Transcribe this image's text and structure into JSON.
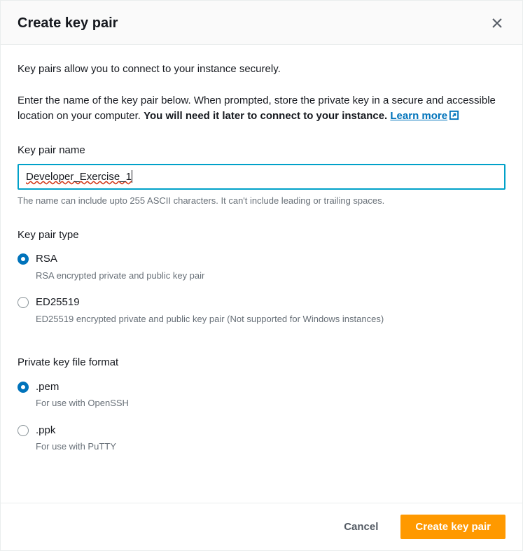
{
  "header": {
    "title": "Create key pair"
  },
  "intro": {
    "line1": "Key pairs allow you to connect to your instance securely.",
    "line2_prefix": "Enter the name of the key pair below. When prompted, store the private key in a secure and accessible location on your computer. ",
    "line2_bold": "You will need it later to connect to your instance.",
    "learn_more": "Learn more"
  },
  "name_field": {
    "label": "Key pair name",
    "value": "Developer_Exercise_1",
    "help": "The name can include upto 255 ASCII characters. It can't include leading or trailing spaces."
  },
  "type_group": {
    "label": "Key pair type",
    "options": [
      {
        "title": "RSA",
        "desc": "RSA encrypted private and public key pair",
        "selected": true
      },
      {
        "title": "ED25519",
        "desc": "ED25519 encrypted private and public key pair (Not supported for Windows instances)",
        "selected": false
      }
    ]
  },
  "format_group": {
    "label": "Private key file format",
    "options": [
      {
        "title": ".pem",
        "desc": "For use with OpenSSH",
        "selected": true
      },
      {
        "title": ".ppk",
        "desc": "For use with PuTTY",
        "selected": false
      }
    ]
  },
  "footer": {
    "cancel": "Cancel",
    "create": "Create key pair"
  }
}
